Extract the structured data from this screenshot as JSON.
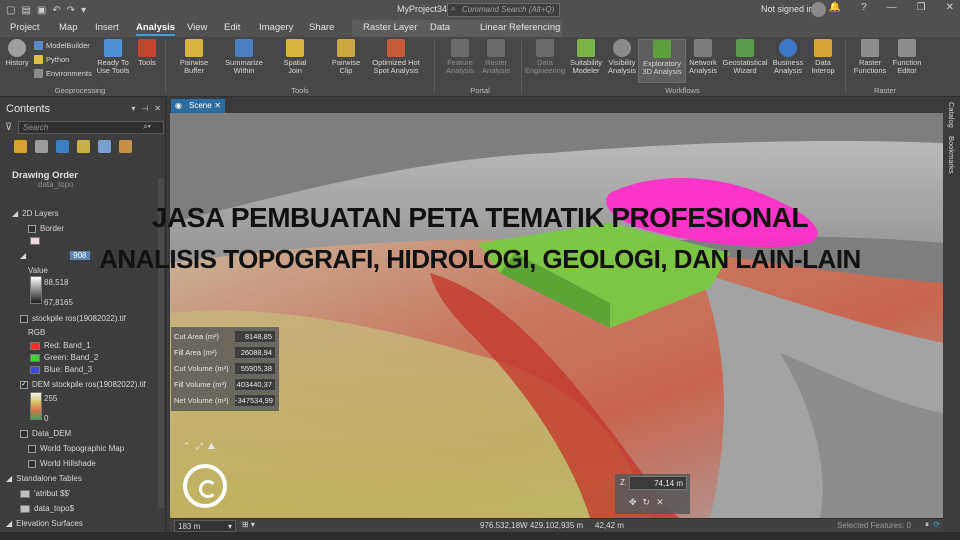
{
  "titlebar": {
    "project_title": "MyProject34",
    "command_search_placeholder": "Command Search (Alt+Q)",
    "signin": "Not signed in",
    "help": "?"
  },
  "tabs": [
    "Project",
    "Map",
    "Insert",
    "Analysis",
    "View",
    "Edit",
    "Imagery",
    "Share"
  ],
  "active_tab": "Analysis",
  "contextual_tabs": [
    "Raster Layer",
    "Data",
    "Linear Referencing"
  ],
  "ribbon": {
    "geoprocessing": {
      "label": "Geoprocessing",
      "history": "History",
      "modelbuilder": "ModelBuilder",
      "python": "Python",
      "environments": "Environments",
      "ready_to_use": "Ready To Use Tools",
      "tools": "Tools"
    },
    "tools_group": {
      "label": "Tools",
      "items": [
        "Pairwise Buffer",
        "Summarize Within",
        "Spatial Join",
        "Pairwise Clip",
        "Optimized Hot Spot Analysis"
      ]
    },
    "portal_group": {
      "label": "Portal",
      "items": [
        "Feature Analysis",
        "Raster Analysis"
      ]
    },
    "workflows_group": {
      "label": "Workflows",
      "items": [
        "Data Engineering",
        "Suitability Modeler",
        "Visibility Analysis",
        "Exploratory 3D Analysis",
        "Network Analysis",
        "Geostatistical Wizard",
        "Business Analysis",
        "Data Interop"
      ]
    },
    "raster_group": {
      "label": "Raster",
      "items": [
        "Raster Functions",
        "Function Editor"
      ]
    }
  },
  "contents": {
    "title": "Contents",
    "search_placeholder": "Search",
    "drawing_order": "Drawing Order",
    "faded_item": "data_topo",
    "layers_2d": "2D Layers",
    "border": "Border",
    "selected_partial": "908",
    "value_label": "Value",
    "value_high": "88,518",
    "value_low": "67,8165",
    "stockpile_tif": "stockpile ros(19082022).tif",
    "rgb": "RGB",
    "red_band": "Red:   Band_1",
    "green_band": "Green: Band_2",
    "blue_band": "Blue:  Band_3",
    "dem_stockpile": "DEM stockpile ros(19082022).tif",
    "dem_high": "255",
    "dem_low": "0",
    "data_dem": "Data_DEM",
    "world_topo": "World Topographic Map",
    "world_hillshade": "World Hillshade",
    "standalone_tables": "Standalone Tables",
    "atribut": "'atribut $$'",
    "data_topo_table": "data_topo$",
    "elevation_surfaces": "Elevation Surfaces"
  },
  "map": {
    "tab_label": "Scene",
    "vtabs": [
      "Catalog",
      "Bookmarks"
    ]
  },
  "overlay": {
    "line1": "JASA PEMBUATAN PETA TEMATIK PROFESIONAL",
    "line2": "ANALISIS TOPOGRAFI, HIDROLOGI, GEOLOGI, DAN LAIN-LAIN"
  },
  "cut_fill": [
    {
      "label": "Cut Area (m²)",
      "value": "8148,85"
    },
    {
      "label": "Fill Area (m²)",
      "value": "26088,94"
    },
    {
      "label": "Cut Volume (m³)",
      "value": "55905,38"
    },
    {
      "label": "Fill Volume (m³)",
      "value": "403440,37"
    },
    {
      "label": "Net Volume (m³)",
      "value": "-347534,99"
    }
  ],
  "z_panel": {
    "label": "Z",
    "value": "74,14 m"
  },
  "status": {
    "scale": "183 m",
    "coords": "976.532,18W 429.102,935 m",
    "elevation": "42,42 m",
    "selected_features": "Selected Features: 0"
  },
  "colors": {
    "accent": "#3f9de0",
    "cut_magenta": "#ff2ec8",
    "fill_green": "#7ac943"
  }
}
